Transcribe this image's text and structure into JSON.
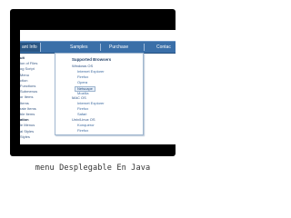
{
  "menubar": {
    "items": [
      "ant Info",
      "Samples",
      "Purchase",
      "Contac"
    ]
  },
  "left_list": [
    {
      "label": "ult",
      "bold": true
    },
    {
      "label": "ion of Files",
      "bold": false
    },
    {
      "label": "og Script",
      "bold": false
    },
    {
      "label": "Menu",
      "bold": false
    },
    {
      "label": "ction",
      "bold": false
    },
    {
      "label": "Functions",
      "bold": false
    },
    {
      "label": "Submenus",
      "bold": false
    },
    {
      "label": "or Items",
      "bold": false
    },
    {
      "label": "Items",
      "bold": false
    },
    {
      "label": "rate Items",
      "bold": false
    },
    {
      "label": "ble Items",
      "bold": false
    },
    {
      "label": "ation",
      "bold": true
    },
    {
      "label": "le Menus",
      "bold": false
    },
    {
      "label": "al Styles",
      "bold": false
    },
    {
      "label": "Styles",
      "bold": false
    }
  ],
  "submenu": {
    "header": "Supported Browsers",
    "rows": [
      {
        "label": "Windows OS",
        "type": "group"
      },
      {
        "label": "Internet Explorer",
        "type": "item"
      },
      {
        "label": "Firefox",
        "type": "item"
      },
      {
        "label": "Opera",
        "type": "item"
      },
      {
        "label": "Netscape",
        "type": "selected"
      },
      {
        "label": "Mozilla",
        "type": "item"
      },
      {
        "label": "MAC OS",
        "type": "group"
      },
      {
        "label": "Internet Explorer",
        "type": "item"
      },
      {
        "label": "Firefox",
        "type": "item"
      },
      {
        "label": "Safari",
        "type": "item"
      },
      {
        "label": "Unix/Linux OS",
        "type": "group"
      },
      {
        "label": "Konqueror",
        "type": "item"
      },
      {
        "label": "Firefox",
        "type": "item"
      }
    ]
  },
  "caption": "menu Desplegable En Java",
  "colors": {
    "frame": "#000000",
    "menubar": "#3a6fa8",
    "link": "#3d6aa0"
  }
}
